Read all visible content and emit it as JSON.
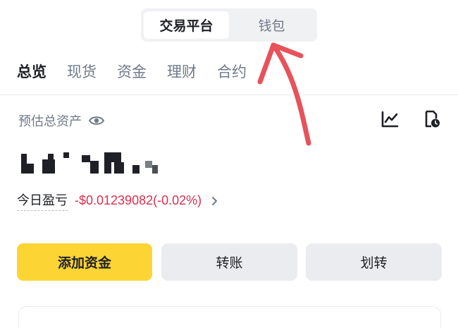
{
  "top_switch": {
    "tabs": [
      {
        "label": "交易平台",
        "active": true
      },
      {
        "label": "钱包",
        "active": false
      }
    ]
  },
  "account_tabs": [
    {
      "label": "总览",
      "active": true
    },
    {
      "label": "现货",
      "active": false
    },
    {
      "label": "资金",
      "active": false
    },
    {
      "label": "理财",
      "active": false
    },
    {
      "label": "合约",
      "active": false
    }
  ],
  "overview": {
    "estimated_label": "预估总资产",
    "pnl_label": "今日盈亏",
    "pnl_value": "-$0.01239082(-0.02%)"
  },
  "actions": {
    "add_funds": "添加资金",
    "transfer": "转账",
    "internal_transfer": "划转"
  },
  "icons": {
    "eye": "eye-icon",
    "chart": "chart-icon",
    "history": "history-icon",
    "chevron": "chevron-right-icon"
  },
  "colors": {
    "primary_yellow": "#fcd535",
    "loss_red": "#d9304e",
    "annotation_arrow": "#e8525a",
    "muted_text": "#707a8a"
  }
}
